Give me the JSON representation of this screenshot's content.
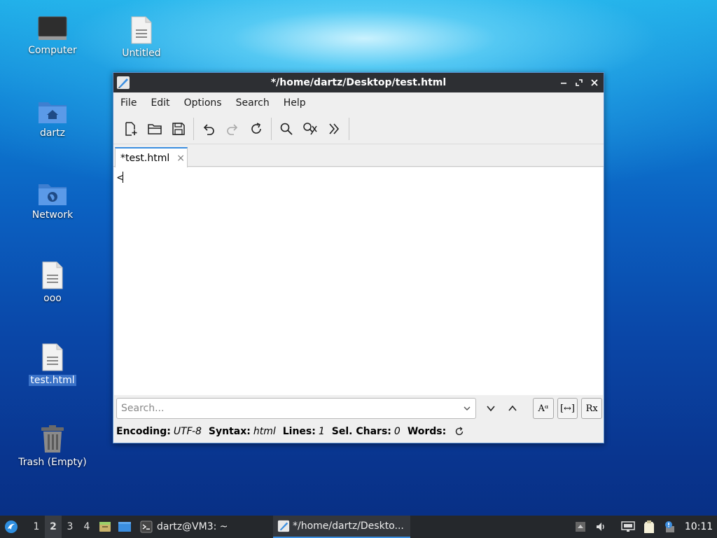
{
  "desktop": {
    "icons": [
      {
        "label": "Computer"
      },
      {
        "label": "Untitled"
      },
      {
        "label": "dartz"
      },
      {
        "label": "Network"
      },
      {
        "label": "ooo"
      },
      {
        "label": "test.html"
      },
      {
        "label": "Trash (Empty)"
      }
    ]
  },
  "window": {
    "title": "*/home/dartz/Desktop/test.html",
    "menus": [
      "File",
      "Edit",
      "Options",
      "Search",
      "Help"
    ],
    "tab": {
      "label": "*test.html",
      "close": "×"
    },
    "editor": {
      "content": "<"
    },
    "search": {
      "placeholder": "Search..."
    },
    "search_options": {
      "case": "Aᵅ",
      "whole_word": "[↔]",
      "regex": "Rx"
    },
    "status": {
      "encoding_label": "Encoding:",
      "encoding_value": "UTF-8",
      "syntax_label": "Syntax:",
      "syntax_value": "html",
      "lines_label": "Lines:",
      "lines_value": "1",
      "selchars_label": "Sel. Chars:",
      "selchars_value": "0",
      "words_label": "Words:"
    }
  },
  "taskbar": {
    "workspaces": [
      "1",
      "2",
      "3",
      "4"
    ],
    "active_workspace": "2",
    "tasks": [
      {
        "label": "dartz@VM3: ~"
      },
      {
        "label": "*/home/dartz/Deskto..."
      }
    ],
    "clock": "10:11"
  },
  "colors": {
    "accent": "#3b8ee0",
    "titlebar": "#2d2f33",
    "taskbar": "#25282c"
  }
}
